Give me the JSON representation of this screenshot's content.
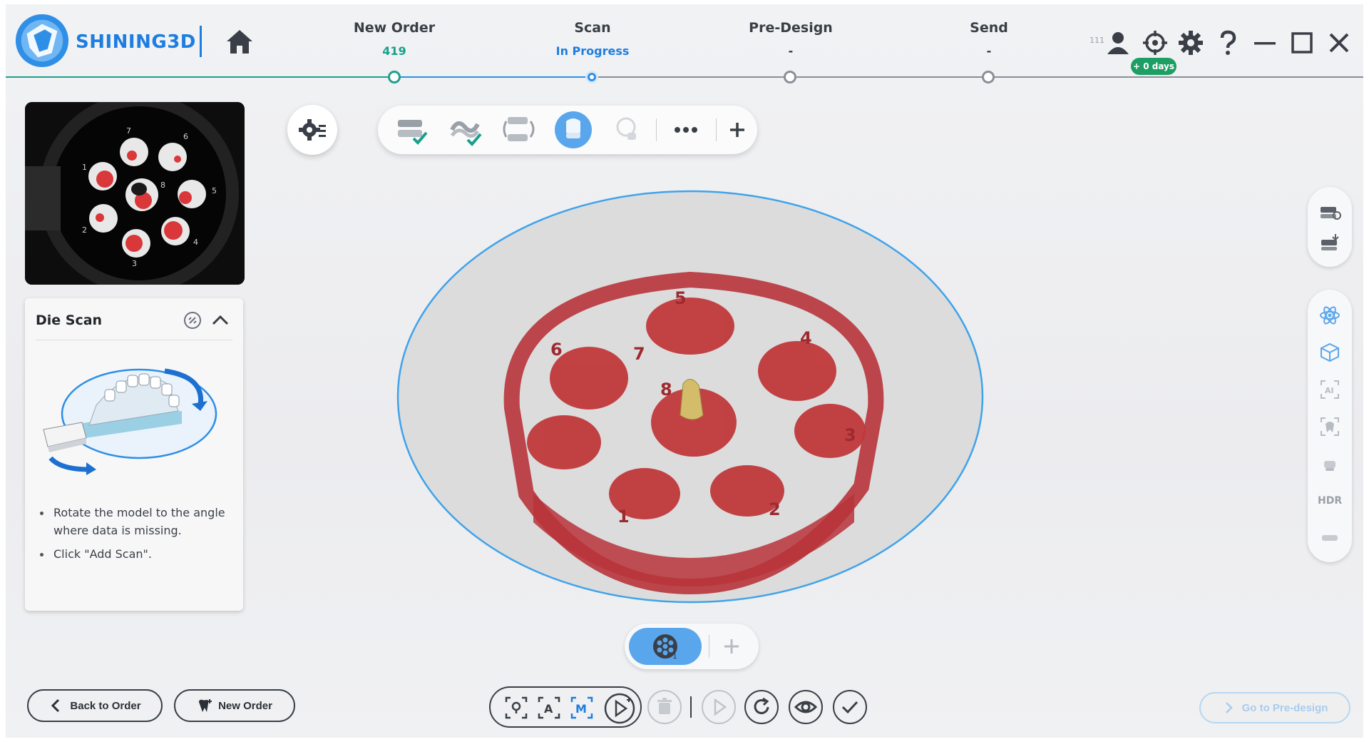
{
  "brand": {
    "name": "SHINING3D"
  },
  "steps": [
    {
      "name": "New Order",
      "sub": "419"
    },
    {
      "name": "Scan",
      "sub": "In Progress"
    },
    {
      "name": "Pre-Design",
      "sub": "-"
    },
    {
      "name": "Send",
      "sub": "-"
    }
  ],
  "header": {
    "tiny_count": "111",
    "days_badge": "+ 0 days"
  },
  "die_scan": {
    "title": "Die Scan",
    "tips": [
      "Rotate the model to the angle where data is missing.",
      "Click \"Add Scan\"."
    ]
  },
  "preview": {
    "slot_labels": [
      "1",
      "2",
      "3",
      "4",
      "5",
      "6",
      "7",
      "8"
    ]
  },
  "viewport": {
    "slot_labels": [
      "1",
      "2",
      "3",
      "4",
      "5",
      "6",
      "7",
      "8"
    ]
  },
  "right_panel": {
    "hdr_label": "HDR"
  },
  "segment": {
    "count": "1"
  },
  "buttons": {
    "back_to_order": "Back to Order",
    "new_order": "New Order",
    "go_to_predesign": "Go to Pre-design"
  },
  "colors": {
    "accent": "#1d7ee0",
    "active_blue": "#5aa6ec",
    "done_green": "#1fa08b",
    "scan_red": "#c0393b"
  }
}
